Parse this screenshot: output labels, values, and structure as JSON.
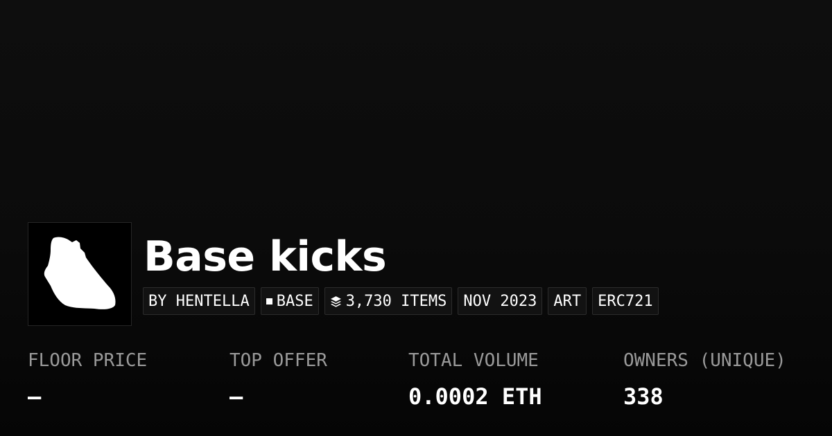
{
  "collection": {
    "title": "Base kicks",
    "image_icon": "sneaker-icon"
  },
  "tags": {
    "creator": "BY HENTELLA",
    "chain": "BASE",
    "chain_icon": "square-icon",
    "items": "3,730 ITEMS",
    "items_icon": "layers-icon",
    "date": "NOV 2023",
    "category": "ART",
    "standard": "ERC721"
  },
  "stats": {
    "floor_price": {
      "label": "FLOOR PRICE",
      "value": "—"
    },
    "top_offer": {
      "label": "TOP OFFER",
      "value": "—"
    },
    "total_volume": {
      "label": "TOTAL VOLUME",
      "value": "0.0002 ETH"
    },
    "owners": {
      "label": "OWNERS (UNIQUE)",
      "value": "338"
    }
  },
  "colors": {
    "background": "#0b0b0b",
    "text": "#ffffff",
    "muted": "#9a9a9a",
    "tag_border": "#2c2c2c"
  }
}
